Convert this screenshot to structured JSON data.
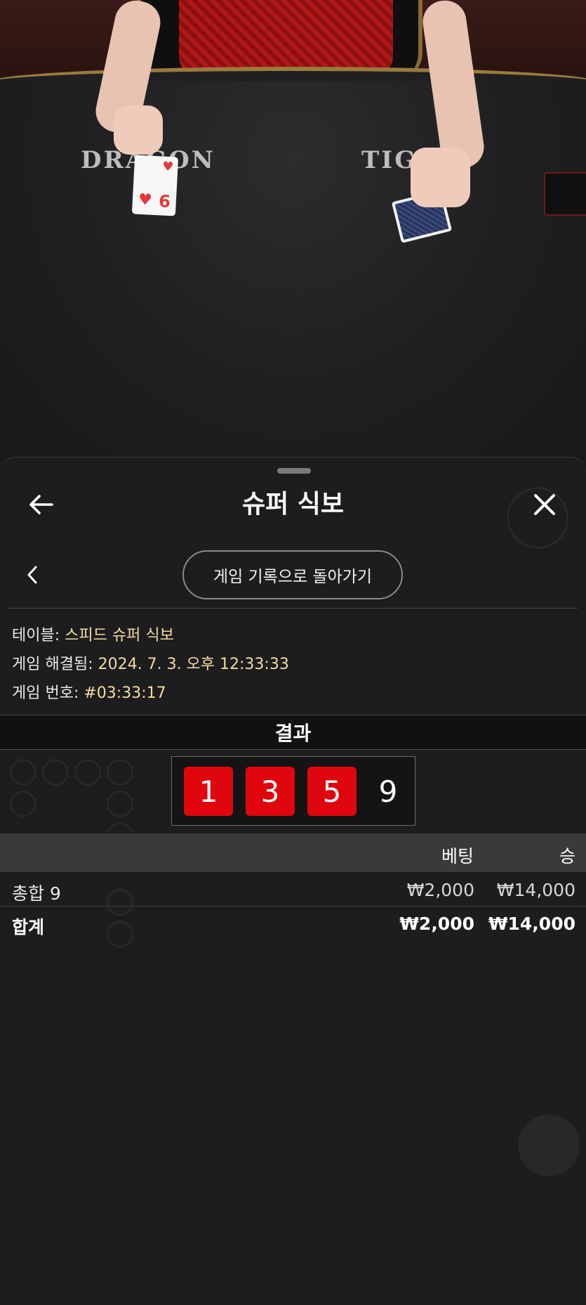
{
  "video": {
    "label_left": "DRAGON",
    "label_right": "TIGER",
    "card_rank": "6",
    "card_suit": "♥"
  },
  "header": {
    "title": "슈퍼 식보",
    "back_icon": "←",
    "close_icon": "✕"
  },
  "nav": {
    "chevron_icon": "‹",
    "history_button": "게임 기록으로 돌아가기"
  },
  "info": {
    "table_label": "테이블: ",
    "table_value": "스피드 슈퍼 식보",
    "resolved_label": "게임 해결됨: ",
    "resolved_value": "2024. 7. 3. 오후 12:33:33",
    "game_no_label": "게임 번호: ",
    "game_no_value": "#03:33:17"
  },
  "result": {
    "title": "결과",
    "dice": [
      "1",
      "3",
      "5"
    ],
    "total": "9",
    "die_color": "#e0060d"
  },
  "bets": {
    "columns": [
      "베팅",
      "승"
    ],
    "rows": [
      {
        "name": "총합 9",
        "bet": "₩2,000",
        "win": "₩14,000"
      }
    ],
    "total_row": {
      "name": "합계",
      "bet": "₩2,000",
      "win": "₩14,000"
    }
  }
}
